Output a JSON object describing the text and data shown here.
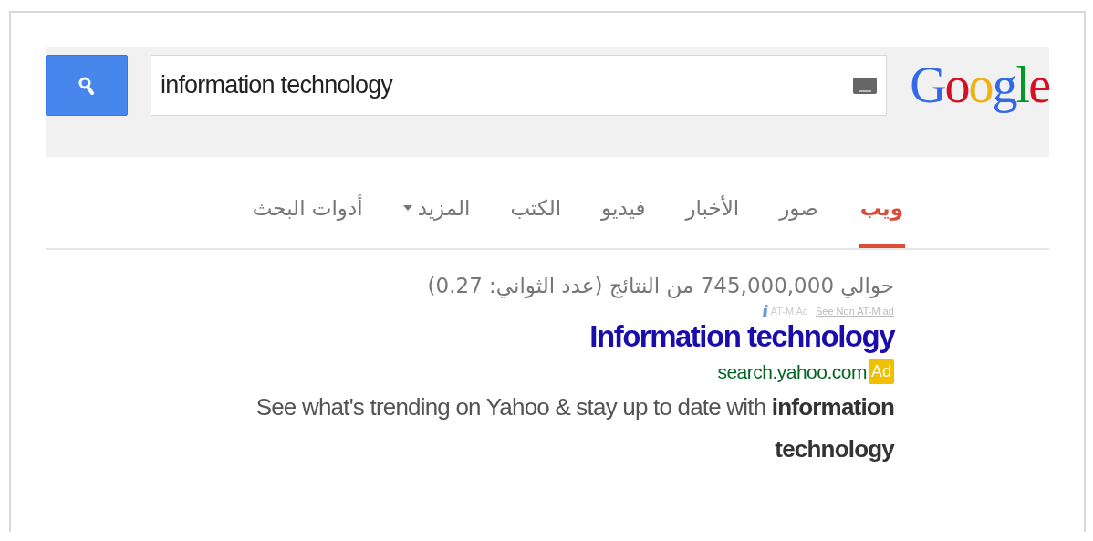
{
  "search": {
    "value": "information technology"
  },
  "logo": {
    "text": "Google"
  },
  "tabs": [
    {
      "label": "ويب",
      "selected": true
    },
    {
      "label": "صور",
      "selected": false
    },
    {
      "label": "الأخبار",
      "selected": false
    },
    {
      "label": "فيديو",
      "selected": false
    },
    {
      "label": "الكتب",
      "selected": false
    },
    {
      "label": "المزيد",
      "selected": false,
      "kind": "menu"
    },
    {
      "label": "أدوات البحث",
      "selected": false
    }
  ],
  "result_stats": "حوالي 745,000,000 من النتائج (عدد الثواني: 0.27)",
  "ad_notice": {
    "label": "AT-M Ad",
    "link": "See Non AT-M ad"
  },
  "result": {
    "title": "Information technology",
    "url": "search.yahoo.com",
    "badge": "Ad",
    "snippet": "See what's trending on Yahoo & stay up to date with **information technology**"
  }
}
